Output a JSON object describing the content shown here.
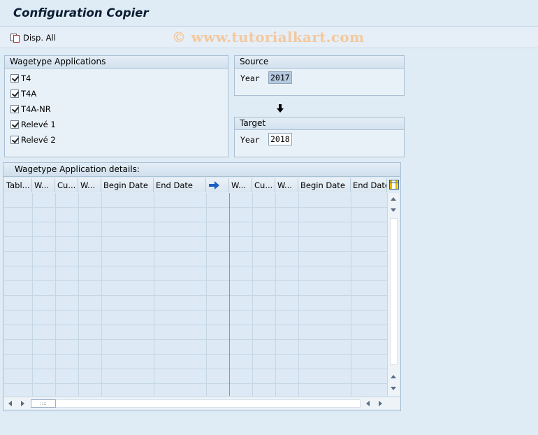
{
  "window": {
    "title": "Configuration Copier"
  },
  "toolbar": {
    "disp_all_label": "Disp. All",
    "watermark": "© www.tutorialkart.com"
  },
  "applications": {
    "title": "Wagetype Applications",
    "items": [
      {
        "label": "T4",
        "checked": true
      },
      {
        "label": "T4A",
        "checked": true
      },
      {
        "label": "T4A-NR",
        "checked": true
      },
      {
        "label": "Relevé 1",
        "checked": true
      },
      {
        "label": "Relevé 2",
        "checked": true
      }
    ]
  },
  "source": {
    "title": "Source",
    "year_label": "Year",
    "year_value": "2017"
  },
  "target": {
    "title": "Target",
    "year_label": "Year",
    "year_value": "2018"
  },
  "details": {
    "title": "Wagetype Application details:",
    "columns": [
      "Tabl...",
      "W...",
      "Cu...",
      "W...",
      "Begin Date",
      "End Date",
      "",
      "W...",
      "Cu...",
      "W...",
      "Begin Date",
      "End Date"
    ],
    "row_count": 0
  },
  "icons": {
    "disp_all": "copy-pages-icon",
    "direction": "down-arrow-icon",
    "column_separator": "right-arrow-icon",
    "table_settings": "table-settings-icon"
  },
  "colors": {
    "background": "#dfebf5",
    "accent_arrow": "#1a5fc6",
    "watermark": "#f3c9a0"
  }
}
